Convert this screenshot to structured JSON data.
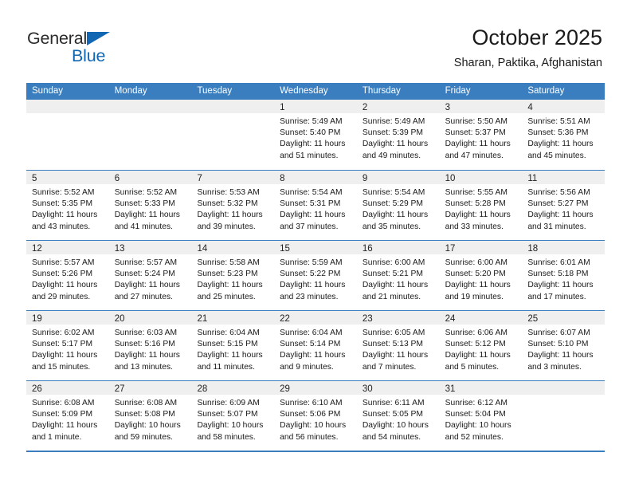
{
  "logo": {
    "word_top": "General",
    "word_bottom": "Blue",
    "triangle_color": "#1267b2"
  },
  "header": {
    "title": "October 2025",
    "subtitle": "Sharan, Paktika, Afghanistan"
  },
  "theme": {
    "header_blue": "#3a7ebf",
    "band_gray": "#efefef",
    "text": "#1a1a1a"
  },
  "weekdays": [
    "Sunday",
    "Monday",
    "Tuesday",
    "Wednesday",
    "Thursday",
    "Friday",
    "Saturday"
  ],
  "weeks": [
    [
      {
        "day": "",
        "sunrise": "",
        "sunset": "",
        "daylight1": "",
        "daylight2": ""
      },
      {
        "day": "",
        "sunrise": "",
        "sunset": "",
        "daylight1": "",
        "daylight2": ""
      },
      {
        "day": "",
        "sunrise": "",
        "sunset": "",
        "daylight1": "",
        "daylight2": ""
      },
      {
        "day": "1",
        "sunrise": "Sunrise: 5:49 AM",
        "sunset": "Sunset: 5:40 PM",
        "daylight1": "Daylight: 11 hours",
        "daylight2": "and 51 minutes."
      },
      {
        "day": "2",
        "sunrise": "Sunrise: 5:49 AM",
        "sunset": "Sunset: 5:39 PM",
        "daylight1": "Daylight: 11 hours",
        "daylight2": "and 49 minutes."
      },
      {
        "day": "3",
        "sunrise": "Sunrise: 5:50 AM",
        "sunset": "Sunset: 5:37 PM",
        "daylight1": "Daylight: 11 hours",
        "daylight2": "and 47 minutes."
      },
      {
        "day": "4",
        "sunrise": "Sunrise: 5:51 AM",
        "sunset": "Sunset: 5:36 PM",
        "daylight1": "Daylight: 11 hours",
        "daylight2": "and 45 minutes."
      }
    ],
    [
      {
        "day": "5",
        "sunrise": "Sunrise: 5:52 AM",
        "sunset": "Sunset: 5:35 PM",
        "daylight1": "Daylight: 11 hours",
        "daylight2": "and 43 minutes."
      },
      {
        "day": "6",
        "sunrise": "Sunrise: 5:52 AM",
        "sunset": "Sunset: 5:33 PM",
        "daylight1": "Daylight: 11 hours",
        "daylight2": "and 41 minutes."
      },
      {
        "day": "7",
        "sunrise": "Sunrise: 5:53 AM",
        "sunset": "Sunset: 5:32 PM",
        "daylight1": "Daylight: 11 hours",
        "daylight2": "and 39 minutes."
      },
      {
        "day": "8",
        "sunrise": "Sunrise: 5:54 AM",
        "sunset": "Sunset: 5:31 PM",
        "daylight1": "Daylight: 11 hours",
        "daylight2": "and 37 minutes."
      },
      {
        "day": "9",
        "sunrise": "Sunrise: 5:54 AM",
        "sunset": "Sunset: 5:29 PM",
        "daylight1": "Daylight: 11 hours",
        "daylight2": "and 35 minutes."
      },
      {
        "day": "10",
        "sunrise": "Sunrise: 5:55 AM",
        "sunset": "Sunset: 5:28 PM",
        "daylight1": "Daylight: 11 hours",
        "daylight2": "and 33 minutes."
      },
      {
        "day": "11",
        "sunrise": "Sunrise: 5:56 AM",
        "sunset": "Sunset: 5:27 PM",
        "daylight1": "Daylight: 11 hours",
        "daylight2": "and 31 minutes."
      }
    ],
    [
      {
        "day": "12",
        "sunrise": "Sunrise: 5:57 AM",
        "sunset": "Sunset: 5:26 PM",
        "daylight1": "Daylight: 11 hours",
        "daylight2": "and 29 minutes."
      },
      {
        "day": "13",
        "sunrise": "Sunrise: 5:57 AM",
        "sunset": "Sunset: 5:24 PM",
        "daylight1": "Daylight: 11 hours",
        "daylight2": "and 27 minutes."
      },
      {
        "day": "14",
        "sunrise": "Sunrise: 5:58 AM",
        "sunset": "Sunset: 5:23 PM",
        "daylight1": "Daylight: 11 hours",
        "daylight2": "and 25 minutes."
      },
      {
        "day": "15",
        "sunrise": "Sunrise: 5:59 AM",
        "sunset": "Sunset: 5:22 PM",
        "daylight1": "Daylight: 11 hours",
        "daylight2": "and 23 minutes."
      },
      {
        "day": "16",
        "sunrise": "Sunrise: 6:00 AM",
        "sunset": "Sunset: 5:21 PM",
        "daylight1": "Daylight: 11 hours",
        "daylight2": "and 21 minutes."
      },
      {
        "day": "17",
        "sunrise": "Sunrise: 6:00 AM",
        "sunset": "Sunset: 5:20 PM",
        "daylight1": "Daylight: 11 hours",
        "daylight2": "and 19 minutes."
      },
      {
        "day": "18",
        "sunrise": "Sunrise: 6:01 AM",
        "sunset": "Sunset: 5:18 PM",
        "daylight1": "Daylight: 11 hours",
        "daylight2": "and 17 minutes."
      }
    ],
    [
      {
        "day": "19",
        "sunrise": "Sunrise: 6:02 AM",
        "sunset": "Sunset: 5:17 PM",
        "daylight1": "Daylight: 11 hours",
        "daylight2": "and 15 minutes."
      },
      {
        "day": "20",
        "sunrise": "Sunrise: 6:03 AM",
        "sunset": "Sunset: 5:16 PM",
        "daylight1": "Daylight: 11 hours",
        "daylight2": "and 13 minutes."
      },
      {
        "day": "21",
        "sunrise": "Sunrise: 6:04 AM",
        "sunset": "Sunset: 5:15 PM",
        "daylight1": "Daylight: 11 hours",
        "daylight2": "and 11 minutes."
      },
      {
        "day": "22",
        "sunrise": "Sunrise: 6:04 AM",
        "sunset": "Sunset: 5:14 PM",
        "daylight1": "Daylight: 11 hours",
        "daylight2": "and 9 minutes."
      },
      {
        "day": "23",
        "sunrise": "Sunrise: 6:05 AM",
        "sunset": "Sunset: 5:13 PM",
        "daylight1": "Daylight: 11 hours",
        "daylight2": "and 7 minutes."
      },
      {
        "day": "24",
        "sunrise": "Sunrise: 6:06 AM",
        "sunset": "Sunset: 5:12 PM",
        "daylight1": "Daylight: 11 hours",
        "daylight2": "and 5 minutes."
      },
      {
        "day": "25",
        "sunrise": "Sunrise: 6:07 AM",
        "sunset": "Sunset: 5:10 PM",
        "daylight1": "Daylight: 11 hours",
        "daylight2": "and 3 minutes."
      }
    ],
    [
      {
        "day": "26",
        "sunrise": "Sunrise: 6:08 AM",
        "sunset": "Sunset: 5:09 PM",
        "daylight1": "Daylight: 11 hours",
        "daylight2": "and 1 minute."
      },
      {
        "day": "27",
        "sunrise": "Sunrise: 6:08 AM",
        "sunset": "Sunset: 5:08 PM",
        "daylight1": "Daylight: 10 hours",
        "daylight2": "and 59 minutes."
      },
      {
        "day": "28",
        "sunrise": "Sunrise: 6:09 AM",
        "sunset": "Sunset: 5:07 PM",
        "daylight1": "Daylight: 10 hours",
        "daylight2": "and 58 minutes."
      },
      {
        "day": "29",
        "sunrise": "Sunrise: 6:10 AM",
        "sunset": "Sunset: 5:06 PM",
        "daylight1": "Daylight: 10 hours",
        "daylight2": "and 56 minutes."
      },
      {
        "day": "30",
        "sunrise": "Sunrise: 6:11 AM",
        "sunset": "Sunset: 5:05 PM",
        "daylight1": "Daylight: 10 hours",
        "daylight2": "and 54 minutes."
      },
      {
        "day": "31",
        "sunrise": "Sunrise: 6:12 AM",
        "sunset": "Sunset: 5:04 PM",
        "daylight1": "Daylight: 10 hours",
        "daylight2": "and 52 minutes."
      },
      {
        "day": "",
        "sunrise": "",
        "sunset": "",
        "daylight1": "",
        "daylight2": ""
      }
    ]
  ]
}
